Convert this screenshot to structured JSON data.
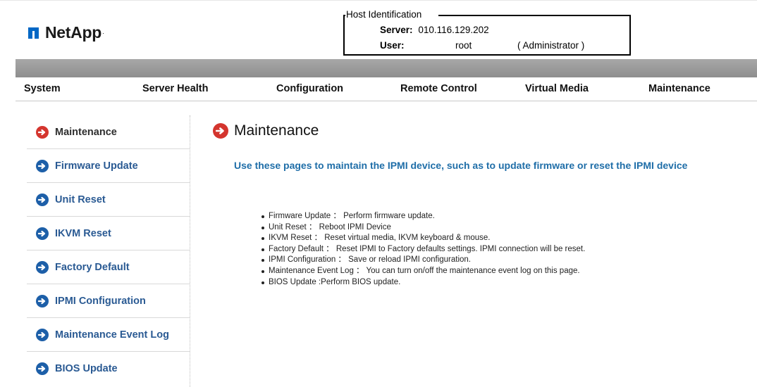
{
  "header": {
    "logo_text": "NetApp",
    "logo_trademark": "·",
    "host_identification": {
      "legend": "Host Identification",
      "server_label": "Server:",
      "server_value": "010.116.129.202",
      "user_label": "User:",
      "user_value": "root",
      "user_role": "( Administrator )"
    }
  },
  "nav": {
    "tabs": [
      {
        "label": "System"
      },
      {
        "label": "Server Health"
      },
      {
        "label": "Configuration"
      },
      {
        "label": "Remote Control"
      },
      {
        "label": "Virtual Media"
      },
      {
        "label": "Maintenance"
      }
    ]
  },
  "sidebar": {
    "items": [
      {
        "label": "Maintenance",
        "active": true
      },
      {
        "label": "Firmware Update",
        "active": false
      },
      {
        "label": "Unit Reset",
        "active": false
      },
      {
        "label": "IKVM Reset",
        "active": false
      },
      {
        "label": "Factory Default",
        "active": false
      },
      {
        "label": "IPMI Configuration",
        "active": false
      },
      {
        "label": "Maintenance Event Log",
        "active": false
      },
      {
        "label": "BIOS Update",
        "active": false
      }
    ]
  },
  "main": {
    "title": "Maintenance",
    "description": "Use these pages to maintain the IPMI device, such as to update firmware or reset the IPMI device",
    "bullets": [
      "Firmware Update ： Perform firmware update.",
      "Unit Reset ： Reboot IPMI Device",
      "IKVM Reset ： Reset virtual media, IKVM keyboard & mouse.",
      "Factory Default ： Reset IPMI to Factory defaults settings. IPMI connection will be reset.",
      "IPMI Configuration ： Save or reload IPMI configuration.",
      "Maintenance Event Log ： You can turn on/off the maintenance event log on this page.",
      "BIOS Update :Perform BIOS update."
    ]
  },
  "colors": {
    "active_icon": "#d4352e",
    "inactive_icon": "#1d5fa8",
    "description_text": "#1f6ea8",
    "brand_blue": "#0067c5"
  },
  "icons": {
    "logo": "netapp-logo-icon",
    "active_arrow": "arrow-circle-right-icon",
    "inactive_arrow": "arrow-circle-right-icon"
  }
}
